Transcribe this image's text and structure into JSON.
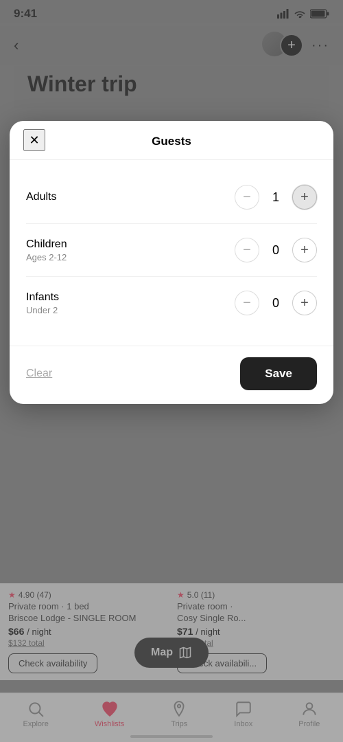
{
  "statusBar": {
    "time": "9:41",
    "batteryFull": true
  },
  "header": {
    "backLabel": "<",
    "title": "Winter trip",
    "moreLabel": "···"
  },
  "modal": {
    "title": "Guests",
    "closeLabel": "✕",
    "rows": [
      {
        "id": "adults",
        "label": "Adults",
        "sublabel": "",
        "count": 1
      },
      {
        "id": "children",
        "label": "Children",
        "sublabel": "Ages 2-12",
        "count": 0
      },
      {
        "id": "infants",
        "label": "Infants",
        "sublabel": "Under 2",
        "count": 0
      }
    ],
    "clearLabel": "Clear",
    "saveLabel": "Save"
  },
  "listings": [
    {
      "rating": "4.90",
      "ratingCount": "47",
      "type": "Private room · 1 bed",
      "name": "Briscoe Lodge - SINGLE ROOM",
      "pricePerNight": "$66",
      "perNightLabel": "/ night",
      "totalPrice": "$132 total",
      "checkBtnLabel": "Check availability"
    },
    {
      "rating": "5.0",
      "ratingCount": "11",
      "type": "Private room ·",
      "name": "Cosy Single Ro...",
      "pricePerNight": "$71",
      "perNightLabel": "/ night",
      "totalPrice": "$141 total",
      "checkBtnLabel": "Check availabili..."
    }
  ],
  "mapButton": {
    "label": "Map"
  },
  "bottomNav": {
    "items": [
      {
        "id": "explore",
        "label": "Explore",
        "active": false
      },
      {
        "id": "wishlists",
        "label": "Wishlists",
        "active": true
      },
      {
        "id": "trips",
        "label": "Trips",
        "active": false
      },
      {
        "id": "inbox",
        "label": "Inbox",
        "active": false
      },
      {
        "id": "profile",
        "label": "Profile",
        "active": false
      }
    ]
  }
}
